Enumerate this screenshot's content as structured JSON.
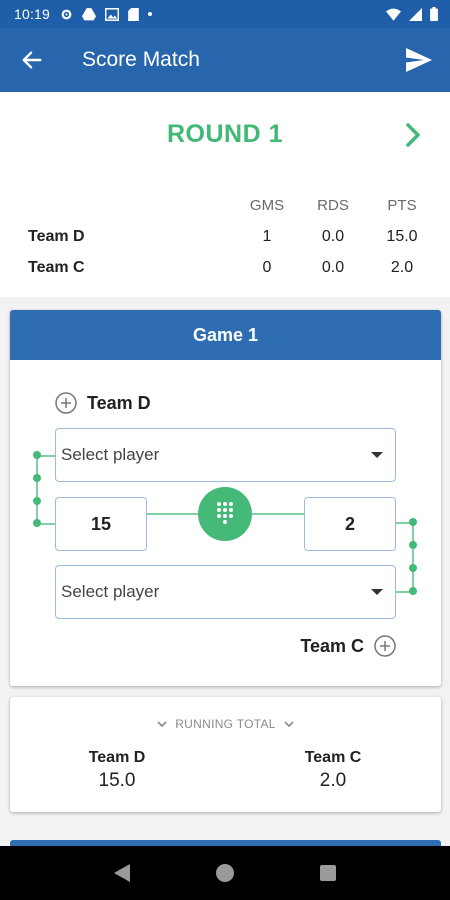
{
  "status_bar": {
    "time": "10:19",
    "bg": "#1f5ea8"
  },
  "app_bar": {
    "title": "Score Match",
    "bg": "#2765ad"
  },
  "round": {
    "title": "ROUND 1",
    "color": "#41b876"
  },
  "score_table": {
    "headers": [
      "GMS",
      "RDS",
      "PTS"
    ],
    "rows": [
      {
        "team": "Team D",
        "gms": "1",
        "rds": "0.0",
        "pts": "15.0"
      },
      {
        "team": "Team C",
        "gms": "0",
        "rds": "0.0",
        "pts": "2.0"
      }
    ]
  },
  "game": {
    "title": "Game 1",
    "team_top": "Team D",
    "team_bottom": "Team C",
    "player_top_placeholder": "Select player",
    "player_bottom_placeholder": "Select player",
    "score_left": "15",
    "score_right": "2"
  },
  "running_total": {
    "label": "RUNNING TOTAL",
    "teams": [
      {
        "name": "Team D",
        "value": "15.0"
      },
      {
        "name": "Team C",
        "value": "2.0"
      }
    ]
  },
  "icons": {
    "back": "arrow-left-icon",
    "send": "send-icon",
    "next": "chevron-right-icon",
    "add": "plus-circle-icon",
    "keypad": "dialpad-icon"
  }
}
